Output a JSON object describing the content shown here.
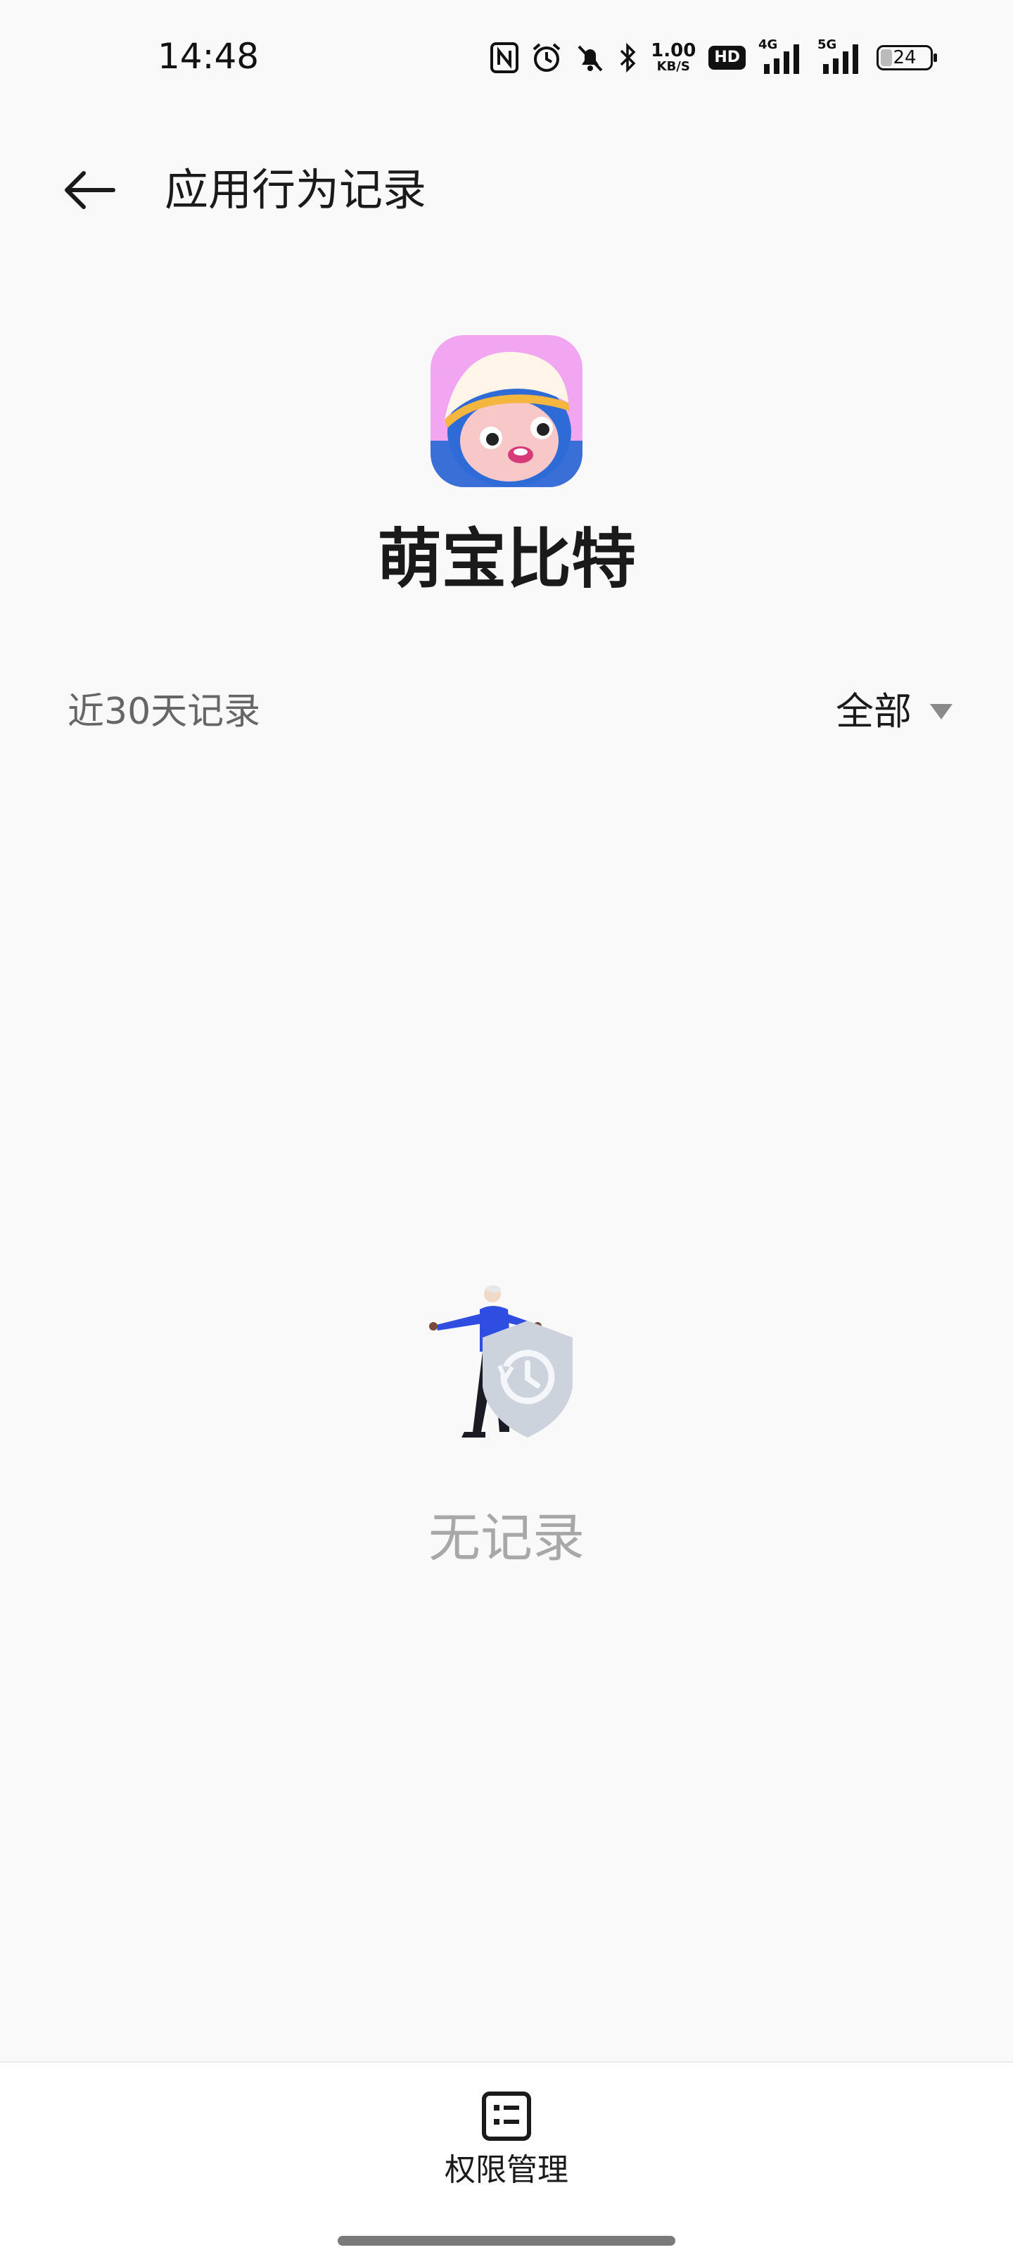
{
  "status_bar": {
    "time": "14:48",
    "net_speed_value": "1.00",
    "net_speed_unit": "KB/S",
    "hd_label": "HD",
    "signal1_label": "4G",
    "signal2_label": "5G",
    "battery_level": "24",
    "icons": [
      "nfc-icon",
      "alarm-icon",
      "mute-icon",
      "bluetooth-icon",
      "signal-icon",
      "battery-icon"
    ]
  },
  "header": {
    "back_icon": "arrow-left-icon",
    "title": "应用行为记录"
  },
  "app": {
    "name": "萌宝比特",
    "icon": "app-icon"
  },
  "filter": {
    "range_label": "近30天记录",
    "selected": "全部",
    "dropdown_icon": "triangle-down-icon"
  },
  "empty_state": {
    "illustration": "shield-history-illustration",
    "text": "无记录"
  },
  "bottom_nav": {
    "permission_label": "权限管理",
    "permission_icon": "list-icon"
  },
  "colors": {
    "background": "#f9f9f9",
    "muted_text": "#a8a8a8",
    "figure_blue": "#2f4de0",
    "shield_gray": "#cdd3dc"
  }
}
